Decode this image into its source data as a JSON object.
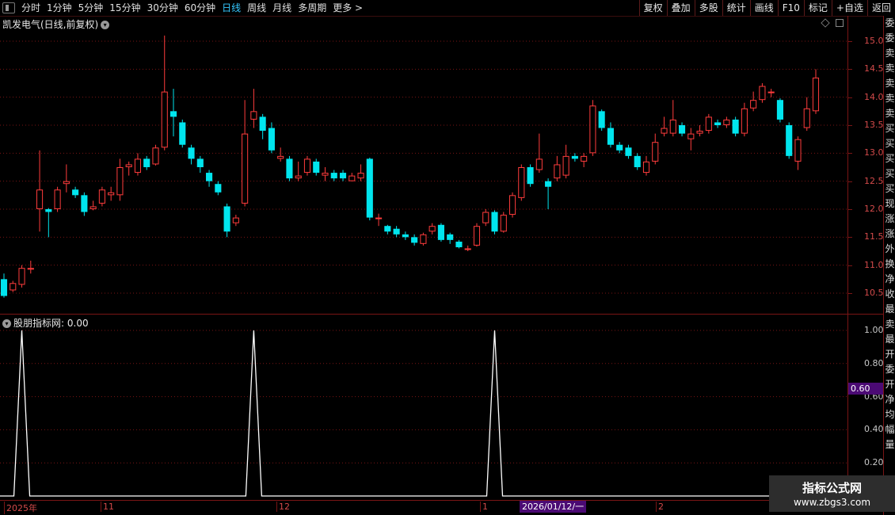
{
  "toolbar": {
    "periods": [
      "分时",
      "1分钟",
      "5分钟",
      "15分钟",
      "30分钟",
      "60分钟",
      "日线",
      "周线",
      "月线",
      "多周期",
      "更多"
    ],
    "active_period": "日线",
    "more_suffix": ">",
    "actions": [
      "复权",
      "叠加",
      "多股",
      "统计",
      "画线",
      "F10",
      "标记",
      "+自选",
      "返回"
    ]
  },
  "main_panel": {
    "title": "凯发电气(日线,前复权)",
    "price_axis": [
      "15.00",
      "14.50",
      "14.00",
      "13.50",
      "13.00",
      "12.50",
      "12.00",
      "11.50",
      "11.00",
      "10.50"
    ]
  },
  "indicator_panel": {
    "title": "股朋指标网",
    "value": ": 0.00",
    "axis": [
      "1.00",
      "0.80",
      "0.60",
      "0.40",
      "0.20"
    ],
    "current_tag": "0.60"
  },
  "x_axis": {
    "labels": [
      "2025年",
      "11",
      "12",
      "1",
      "2"
    ],
    "cursor_label": "2026/01/12/一"
  },
  "right_strip": [
    "委",
    "委",
    "卖",
    "卖",
    "卖",
    "卖",
    "卖",
    "买",
    "买",
    "买",
    "买",
    "买",
    "现",
    "涨",
    "涨",
    "外",
    "换",
    "净",
    "收",
    "最",
    "卖",
    "最",
    "开",
    "委",
    "开",
    "净",
    "均",
    "幅",
    "量"
  ],
  "watermark": {
    "title": "指标公式网",
    "url": "www.zbgs3.com"
  },
  "colors": {
    "up": "#ff3c3c",
    "down": "#00e5ee",
    "grid": "#7a1515",
    "line": "#ffffff"
  },
  "chart_data": {
    "type": "candlestick",
    "ylim": [
      10.3,
      15.2
    ],
    "candles": [
      [
        10.75,
        10.45,
        10.85,
        10.42
      ],
      [
        10.55,
        10.68,
        10.72,
        10.52
      ],
      [
        10.65,
        10.95,
        11.0,
        10.6
      ],
      [
        10.92,
        10.95,
        11.08,
        10.85
      ],
      [
        12.0,
        12.35,
        13.05,
        11.6
      ],
      [
        12.0,
        11.95,
        12.02,
        11.5
      ],
      [
        12.0,
        12.35,
        12.4,
        11.95
      ],
      [
        12.45,
        12.5,
        12.8,
        12.3
      ],
      [
        12.35,
        12.25,
        12.4,
        12.2
      ],
      [
        12.25,
        11.95,
        12.3,
        11.88
      ],
      [
        12.0,
        12.05,
        12.15,
        11.98
      ],
      [
        12.1,
        12.35,
        12.4,
        12.05
      ],
      [
        12.25,
        12.3,
        12.4,
        12.15
      ],
      [
        12.25,
        12.75,
        12.9,
        12.15
      ],
      [
        12.75,
        12.8,
        12.85,
        12.6
      ],
      [
        12.65,
        12.9,
        13.0,
        12.6
      ],
      [
        12.9,
        12.75,
        12.95,
        12.7
      ],
      [
        12.8,
        13.1,
        13.15,
        12.78
      ],
      [
        13.1,
        14.1,
        15.1,
        13.05
      ],
      [
        13.75,
        13.65,
        14.15,
        13.3
      ],
      [
        13.55,
        13.15,
        13.6,
        13.1
      ],
      [
        13.1,
        12.9,
        13.15,
        12.8
      ],
      [
        12.9,
        12.75,
        12.95,
        12.65
      ],
      [
        12.65,
        12.5,
        12.7,
        12.4
      ],
      [
        12.45,
        12.3,
        12.5,
        12.25
      ],
      [
        12.05,
        11.6,
        12.1,
        11.5
      ],
      [
        11.75,
        11.85,
        11.9,
        11.7
      ],
      [
        12.1,
        13.35,
        13.95,
        12.05
      ],
      [
        13.6,
        13.75,
        14.15,
        13.45
      ],
      [
        13.65,
        13.4,
        13.7,
        13.25
      ],
      [
        13.45,
        13.05,
        13.55,
        13.0
      ],
      [
        12.9,
        12.95,
        13.1,
        12.85
      ],
      [
        12.9,
        12.55,
        12.95,
        12.5
      ],
      [
        12.55,
        12.6,
        12.85,
        12.5
      ],
      [
        12.65,
        12.9,
        12.95,
        12.6
      ],
      [
        12.85,
        12.65,
        12.9,
        12.6
      ],
      [
        12.6,
        12.65,
        12.75,
        12.5
      ],
      [
        12.65,
        12.55,
        12.7,
        12.5
      ],
      [
        12.65,
        12.55,
        12.7,
        12.5
      ],
      [
        12.5,
        12.6,
        12.65,
        12.5
      ],
      [
        12.55,
        12.65,
        12.8,
        12.5
      ],
      [
        12.9,
        11.85,
        12.92,
        11.8
      ],
      [
        11.85,
        11.85,
        11.92,
        11.7
      ],
      [
        11.7,
        11.6,
        11.72,
        11.55
      ],
      [
        11.65,
        11.55,
        11.7,
        11.5
      ],
      [
        11.55,
        11.5,
        11.6,
        11.45
      ],
      [
        11.5,
        11.4,
        11.55,
        11.35
      ],
      [
        11.38,
        11.55,
        11.58,
        11.35
      ],
      [
        11.6,
        11.7,
        11.75,
        11.55
      ],
      [
        11.72,
        11.45,
        11.75,
        11.42
      ],
      [
        11.55,
        11.45,
        11.58,
        11.38
      ],
      [
        11.42,
        11.32,
        11.45,
        11.3
      ],
      [
        11.3,
        11.3,
        11.35,
        11.25
      ],
      [
        11.35,
        11.7,
        11.75,
        11.33
      ],
      [
        11.75,
        11.95,
        12.0,
        11.7
      ],
      [
        11.95,
        11.6,
        11.98,
        11.55
      ],
      [
        11.6,
        11.9,
        11.95,
        11.58
      ],
      [
        11.9,
        12.25,
        12.3,
        11.85
      ],
      [
        12.2,
        12.75,
        12.8,
        12.15
      ],
      [
        12.75,
        12.45,
        12.8,
        12.4
      ],
      [
        12.7,
        12.9,
        13.35,
        12.65
      ],
      [
        12.5,
        12.4,
        12.55,
        12.0
      ],
      [
        12.55,
        12.8,
        12.95,
        12.5
      ],
      [
        12.6,
        12.95,
        13.15,
        12.55
      ],
      [
        12.95,
        12.9,
        13.0,
        12.85
      ],
      [
        12.85,
        12.95,
        13.0,
        12.75
      ],
      [
        13.0,
        13.85,
        13.95,
        12.95
      ],
      [
        13.75,
        13.45,
        13.78,
        13.4
      ],
      [
        13.45,
        13.15,
        13.55,
        13.1
      ],
      [
        13.15,
        13.05,
        13.2,
        13.0
      ],
      [
        13.1,
        12.95,
        13.15,
        12.9
      ],
      [
        12.95,
        12.75,
        13.0,
        12.7
      ],
      [
        12.65,
        12.85,
        12.95,
        12.6
      ],
      [
        12.85,
        13.2,
        13.35,
        12.8
      ],
      [
        13.35,
        13.45,
        13.65,
        13.3
      ],
      [
        13.35,
        13.6,
        13.95,
        13.3
      ],
      [
        13.5,
        13.35,
        13.55,
        13.3
      ],
      [
        13.25,
        13.35,
        13.45,
        13.05
      ],
      [
        13.35,
        13.4,
        13.5,
        13.3
      ],
      [
        13.4,
        13.65,
        13.7,
        13.35
      ],
      [
        13.55,
        13.5,
        13.6,
        13.45
      ],
      [
        13.5,
        13.6,
        13.65,
        13.45
      ],
      [
        13.6,
        13.35,
        13.65,
        13.3
      ],
      [
        13.35,
        13.8,
        13.9,
        13.3
      ],
      [
        13.8,
        13.95,
        14.1,
        13.75
      ],
      [
        13.95,
        14.2,
        14.25,
        13.9
      ],
      [
        14.1,
        14.1,
        14.15,
        14.0
      ],
      [
        13.95,
        13.6,
        13.98,
        13.55
      ],
      [
        13.5,
        12.95,
        13.55,
        12.9
      ],
      [
        12.85,
        13.25,
        13.3,
        12.7
      ],
      [
        13.45,
        13.8,
        14.0,
        13.4
      ],
      [
        13.75,
        14.35,
        14.5,
        13.7
      ]
    ],
    "indicator": {
      "name": "股朋指标网",
      "ylim": [
        0,
        1.0
      ],
      "spikes_at": [
        2,
        28,
        55
      ],
      "values_note_free": true
    }
  }
}
